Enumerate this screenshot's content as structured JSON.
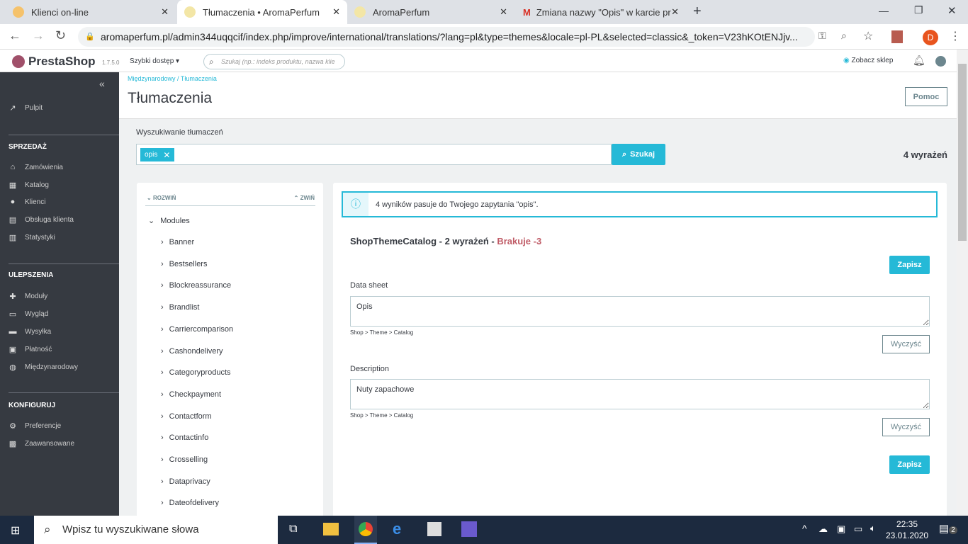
{
  "browser": {
    "tabs": [
      {
        "title": "Klienci on-line"
      },
      {
        "title": "Tłumaczenia • AromaPerfum",
        "active": true
      },
      {
        "title": "AromaPerfum"
      },
      {
        "title": "Zmiana nazwy \"Opis\" w karcie pr"
      }
    ],
    "url": "aromaperfum.pl/admin344uqqcif/index.php/improve/international/translations/?lang=pl&type=themes&locale=pl-PL&selected=classic&_token=V23hKOtENJjv...",
    "profile_initial": "D"
  },
  "header": {
    "logo": "PrestaShop",
    "version": "1.7.5.0",
    "quick_access": "Szybki dostęp",
    "search_placeholder": "Szukaj (np.: indeks produktu, nazwa klie",
    "view_shop": "Zobacz sklep"
  },
  "sidebar": {
    "dashboard": "Pulpit",
    "sections": [
      {
        "title": "SPRZEDAŻ",
        "items": [
          "Zamówienia",
          "Katalog",
          "Klienci",
          "Obsługa klienta",
          "Statystyki"
        ]
      },
      {
        "title": "ULEPSZENIA",
        "items": [
          "Moduły",
          "Wygląd",
          "Wysyłka",
          "Płatność",
          "Międzynarodowy"
        ]
      },
      {
        "title": "KONFIGURUJ",
        "items": [
          "Preferencje",
          "Zaawansowane"
        ]
      }
    ]
  },
  "page": {
    "breadcrumb_parent": "Międzynarodowy",
    "breadcrumb_current": "Tłumaczenia",
    "title": "Tłumaczenia",
    "help": "Pomoc",
    "search_label": "Wyszukiwanie tłumaczeń",
    "search_tag": "opis",
    "search_button": "Szukaj",
    "count": "4 wyrażeń"
  },
  "tree": {
    "expand": "ROZWIŃ",
    "collapse": "ZWIŃ",
    "root": "Modules",
    "items": [
      "Banner",
      "Bestsellers",
      "Blockreassurance",
      "Brandlist",
      "Carriercomparison",
      "Cashondelivery",
      "Categoryproducts",
      "Checkpayment",
      "Contactform",
      "Contactinfo",
      "Crosselling",
      "Dataprivacy",
      "Dateofdelivery"
    ]
  },
  "results": {
    "info": "4 wyników pasuje do Twojego zapytania \"opis\".",
    "domain": "ShopThemeCatalog - 2 wyrażeń - ",
    "missing": "Brakuje -3",
    "save": "Zapisz",
    "clear": "Wyczyść",
    "entries": [
      {
        "label": "Data sheet",
        "value": "Opis",
        "path": "Shop > Theme > Catalog"
      },
      {
        "label": "Description",
        "value": "Nuty zapachowe",
        "path": "Shop > Theme > Catalog"
      }
    ]
  },
  "taskbar": {
    "search_placeholder": "Wpisz tu wyszukiwane słowa",
    "time": "22:35",
    "date": "23.01.2020",
    "notifications": "2"
  },
  "colors": {
    "accent": "#25b9d7",
    "sidebar": "#363a41",
    "missing": "#c05c67"
  }
}
